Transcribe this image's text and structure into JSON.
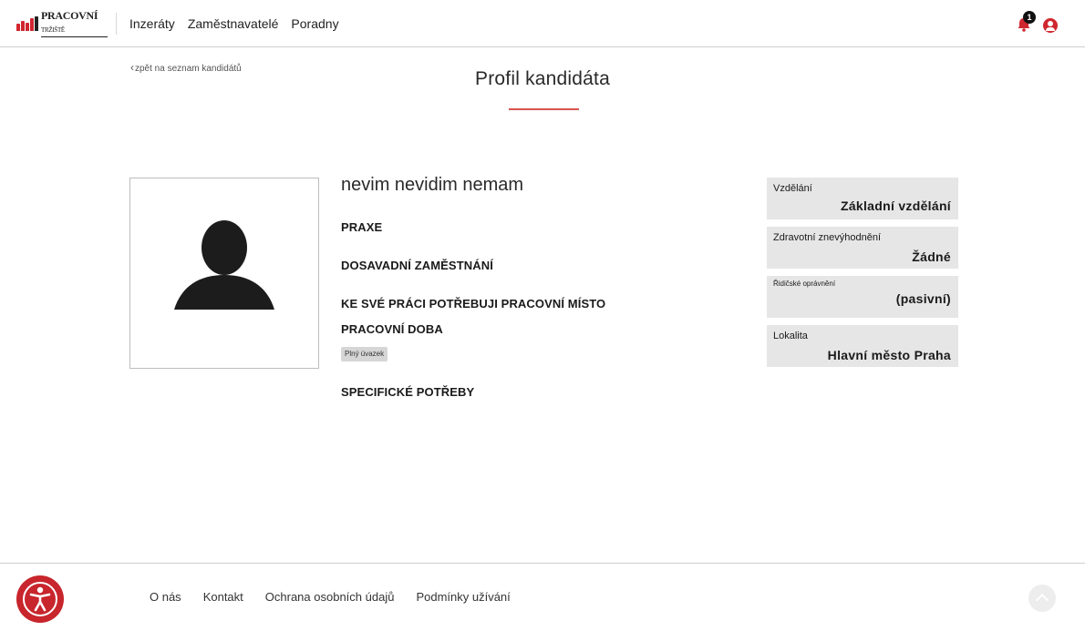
{
  "header": {
    "logo_text": "PRACOVNÍ TRŽIŠTĚ",
    "logo_main": "PRACOVNÍ",
    "logo_small": "TRŽIŠTĚ",
    "nav": [
      "Inzeráty",
      "Zaměstnavatelé",
      "Poradny"
    ],
    "notification_count": "1",
    "icons": {
      "notifications": "bell-icon",
      "account": "user-circle-icon"
    }
  },
  "page": {
    "back_link": "zpět na seznam kandidátů",
    "title": "Profil kandidáta"
  },
  "candidate": {
    "name": "nevim nevidim nemam",
    "sections": {
      "praxe": "PRAXE",
      "dosavadni": "DOSAVADNÍ ZAMĚSTNÁNÍ",
      "pracovni_misto": "KE SVÉ PRÁCI POTŘEBUJI PRACOVNÍ MÍSTO",
      "pracovni_doba": "PRACOVNÍ DOBA",
      "specificke": "SPECIFICKÉ POTŘEBY"
    },
    "work_time_tag": "Plný úvazek"
  },
  "info": [
    {
      "label": "Vzdělání",
      "value": "Základní vzdělání"
    },
    {
      "label": "Zdravotní znevýhodnění",
      "value": "Žádné"
    },
    {
      "label": "Řidičské oprávnění",
      "value": "(pasivní)"
    },
    {
      "label": "Lokalita",
      "value": "Hlavní město Praha"
    }
  ],
  "footer": {
    "links": [
      "O nás",
      "Kontakt",
      "Ochrana osobních údajů",
      "Podmínky užívání"
    ],
    "icons": {
      "accessibility": "accessibility-icon",
      "scroll_top": "chevron-up-icon"
    }
  },
  "colors": {
    "accent": "#d0262f",
    "card_bg": "#e6e6e6"
  }
}
